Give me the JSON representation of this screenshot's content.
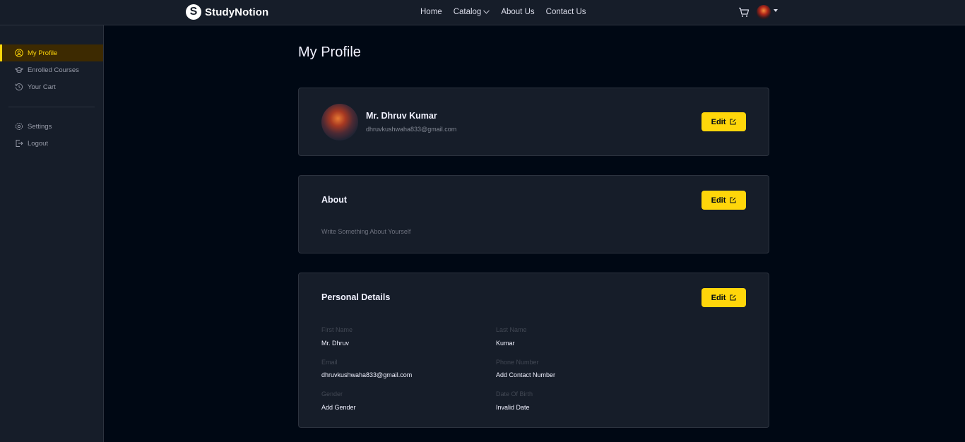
{
  "nav": {
    "logo_letter": "S",
    "logo_text": "StudyNotion",
    "links": [
      "Home",
      "Catalog",
      "About Us",
      "Contact Us"
    ]
  },
  "sidebar": {
    "items": [
      {
        "label": "My Profile",
        "icon": "user-circle-icon",
        "active": true
      },
      {
        "label": "Enrolled Courses",
        "icon": "graduation-cap-icon",
        "active": false
      },
      {
        "label": "Your Cart",
        "icon": "history-icon",
        "active": false
      },
      {
        "label": "Settings",
        "icon": "gear-icon",
        "active": false
      },
      {
        "label": "Logout",
        "icon": "logout-icon",
        "active": false
      }
    ]
  },
  "main": {
    "title": "My Profile",
    "profile": {
      "name": "Mr. Dhruv Kumar",
      "email": "dhruvkushwaha833@gmail.com",
      "edit_label": "Edit"
    },
    "about": {
      "heading": "About",
      "text": "Write Something About Yourself",
      "edit_label": "Edit"
    },
    "personal": {
      "heading": "Personal Details",
      "edit_label": "Edit",
      "fields": [
        {
          "label": "First Name",
          "value": "Mr. Dhruv"
        },
        {
          "label": "Last Name",
          "value": "Kumar"
        },
        {
          "label": "Email",
          "value": "dhruvkushwaha833@gmail.com"
        },
        {
          "label": "Phone Number",
          "value": "Add Contact Number"
        },
        {
          "label": "Gender",
          "value": "Add Gender"
        },
        {
          "label": "Date Of Birth",
          "value": "Invalid Date"
        }
      ]
    }
  },
  "colors": {
    "accent": "#FFD60A",
    "background": "#000814",
    "panel": "#161D29",
    "border": "#2C333F"
  }
}
